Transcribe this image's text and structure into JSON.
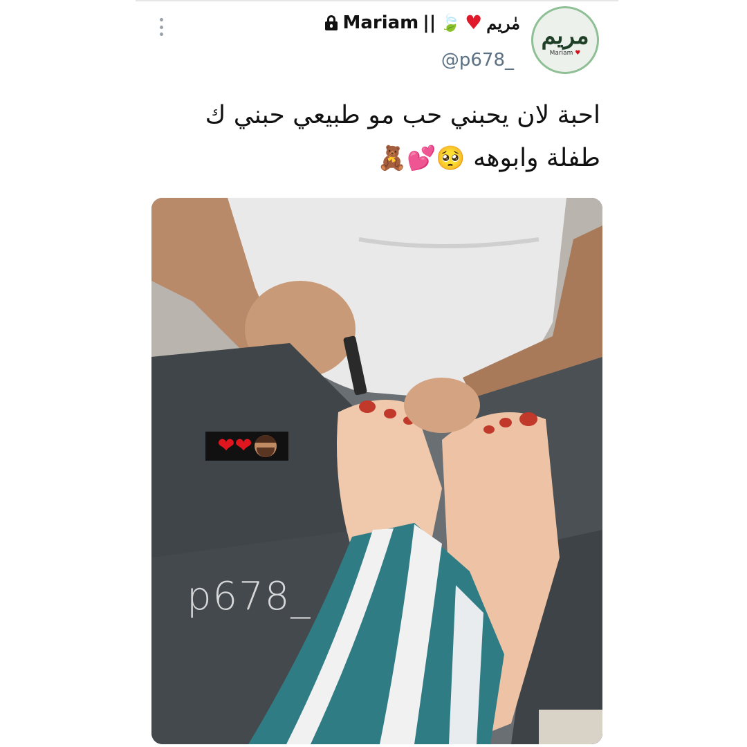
{
  "post": {
    "display_name_latin": "Mariam",
    "display_name_separator": "||",
    "display_name_arabic": "مٰريم",
    "handle": "@p678_",
    "avatar_text": "مريم",
    "avatar_subtext": "Mariam",
    "text_line_1": "احبة لان يحبني حب مو طبيعي حبني ك",
    "text_line_2": "طفلة وابوهه",
    "text_emojis": "🥺💕🧸",
    "icons": [
      "lock-icon",
      "leaf-icon",
      "red-heart-icon",
      "more-options-icon"
    ]
  },
  "photo": {
    "sticker_emojis": "❤❤",
    "watermark": "p678_"
  },
  "colors": {
    "handle": "#5b7083",
    "avatar_border": "#8fbf95",
    "heart": "#e01a2b"
  }
}
